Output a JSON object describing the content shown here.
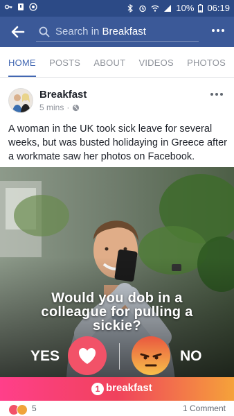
{
  "status_bar": {
    "battery": "10%",
    "time": "06:19"
  },
  "app_bar": {
    "search_prefix": "Search in",
    "search_page": "Breakfast"
  },
  "tabs": [
    {
      "label": "HOME",
      "active": true
    },
    {
      "label": "POSTS",
      "active": false
    },
    {
      "label": "ABOUT",
      "active": false
    },
    {
      "label": "VIDEOS",
      "active": false
    },
    {
      "label": "PHOTOS",
      "active": false
    }
  ],
  "post": {
    "page_name": "Breakfast",
    "time_ago": "5 mins",
    "separator": "·",
    "privacy_icon": "globe-icon",
    "text": "A woman in the UK took sick leave for several weeks, but was busted holidaying in Greece after a workmate saw her photos on Facebook.",
    "image": {
      "headline_line1": "Would you dob in a",
      "headline_line2": "colleague for pulling a",
      "headline_line3": "sickie?",
      "yes_label": "YES",
      "no_label": "NO",
      "yes_icon": "heart-icon",
      "no_icon": "angry-face-icon",
      "brand_badge": "1",
      "brand_name": "breakfast"
    }
  },
  "footer": {
    "reaction_count": "5",
    "comment_count": "1 Comment"
  },
  "colors": {
    "facebook_blue": "#3b5998",
    "status_bar": "#2c4a86",
    "active_tab": "#4267b2",
    "love_red": "#f25268",
    "brand_gradient_start": "#ff3f8a",
    "brand_gradient_end": "#f5a23a"
  }
}
